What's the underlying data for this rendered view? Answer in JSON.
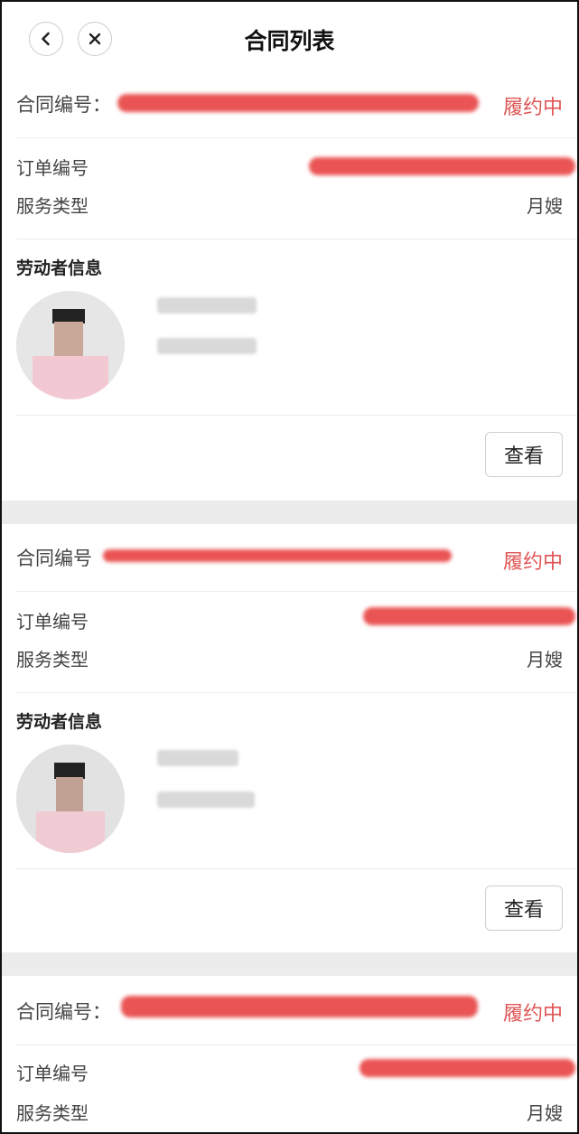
{
  "header": {
    "title": "合同列表",
    "back_icon": "chevron-left-icon",
    "close_icon": "close-icon"
  },
  "colors": {
    "status": "#e05555",
    "redaction": "#e94b4b",
    "separator": "#ececec"
  },
  "cards": [
    {
      "contract_label": "合同编号：",
      "status": "履约中",
      "order_label": "订单编号",
      "service_label": "服务类型",
      "service_value": "月嫂",
      "worker_title": "劳动者信息",
      "view_button": "查看"
    },
    {
      "contract_label": "合同编号",
      "status": "履约中",
      "order_label": "订单编号",
      "service_label": "服务类型",
      "service_value": "月嫂",
      "worker_title": "劳动者信息",
      "view_button": "查看"
    },
    {
      "contract_label": "合同编号：",
      "status": "履约中",
      "order_label": "订单编号",
      "service_label": "服务类型",
      "service_value": "月嫂"
    }
  ]
}
